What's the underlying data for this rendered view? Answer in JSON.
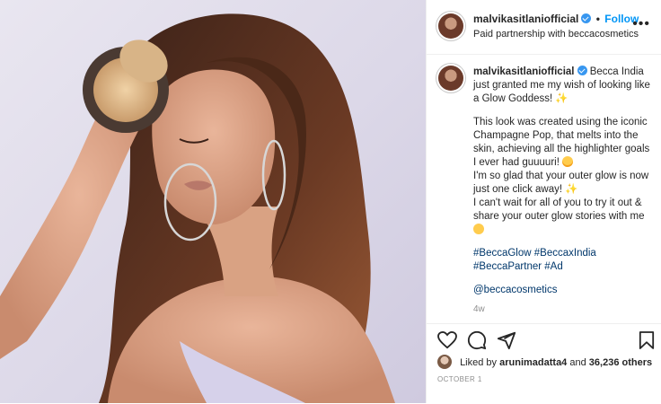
{
  "post": {
    "author": "malvikasitlaniofficial",
    "follow_label": "Follow",
    "dot": "•",
    "subtitle": "Paid partnership with beccacosmetics",
    "more_label": "•••"
  },
  "caption": {
    "author": "malvikasitlaniofficial",
    "line1": "Becca India just granted me my wish of looking like a Glow Goddess! ✨",
    "line2a": "This look was created using the iconic Champagne Pop, that melts into the skin, achieving all the highlighter goals I ever had guuuuri!",
    "line2b": "I'm so glad that your outer glow is now just one click away! ✨",
    "line2c": "I can't wait for all of you to try it out & share your outer glow stories with me",
    "hashtags": [
      "#BeccaGlow",
      "#BeccaxIndia",
      "#BeccaPartner",
      "#Ad"
    ],
    "mention": "@beccacosmetics",
    "time_ago": "4w"
  },
  "engagement": {
    "liked_by_prefix": "Liked by",
    "liked_by_user": "arunimadatta4",
    "liked_by_and": "and",
    "others_count": "36,236 others",
    "date": "OCTOBER 1"
  },
  "icons": {
    "like": "heart-icon",
    "comment": "comment-icon",
    "share": "share-icon",
    "save": "bookmark-icon"
  },
  "colors": {
    "link_blue": "#0095f6",
    "hashtag": "#00376b",
    "verified": "#3897f0",
    "muted": "#8e8e8e"
  }
}
